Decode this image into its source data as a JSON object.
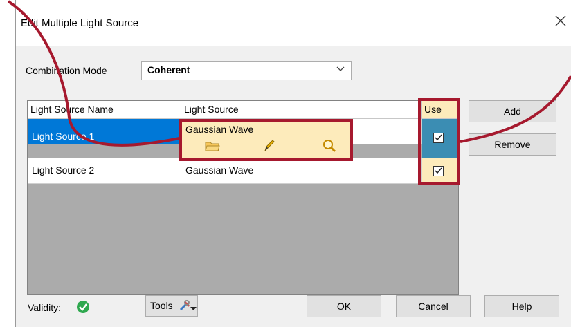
{
  "window": {
    "title": "Edit Multiple Light Source",
    "close_label": "✕"
  },
  "combination": {
    "label": "Combination Mode",
    "value": "Coherent"
  },
  "table": {
    "headers": [
      "Light Source Name",
      "Light Source",
      "Use"
    ],
    "rows": [
      {
        "name": "Light Source 1",
        "source": "Gaussian Wave",
        "use": true,
        "selected": true
      },
      {
        "name": "Light Source 2",
        "source": "Gaussian Wave",
        "use": true,
        "selected": false
      }
    ]
  },
  "side_buttons": {
    "add": "Add",
    "remove": "Remove"
  },
  "footer": {
    "validity_label": "Validity:",
    "tools_label": "Tools",
    "ok": "OK",
    "cancel": "Cancel",
    "help": "Help"
  },
  "colors": {
    "selection_blue": "#0078d7",
    "highlight_cell": "#fdebbb",
    "use_column_bg": "#fdebbb",
    "selected_use_bg": "#3b8db3",
    "annotation_red": "#a6192e",
    "validity_green": "#2fa84f"
  },
  "icons": [
    "open-folder-icon",
    "pencil-icon",
    "magnifier-icon",
    "checkmark-icon",
    "tools-icon",
    "chevron-down-icon",
    "close-icon"
  ]
}
